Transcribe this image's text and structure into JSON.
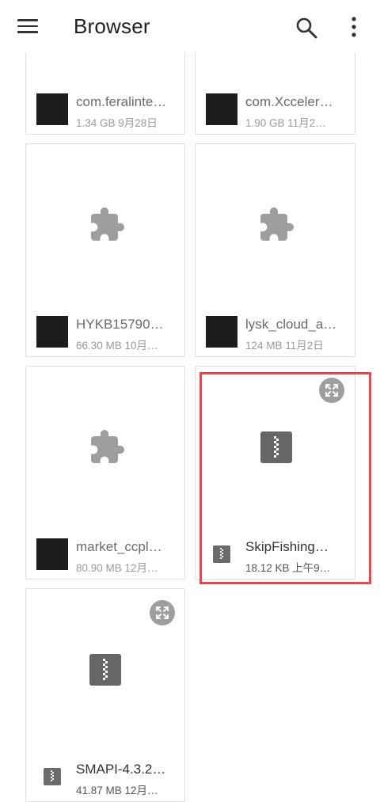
{
  "appbar": {
    "title": "Browser",
    "menu_icon": "hamburger-menu-icon",
    "search_icon": "search-icon",
    "more_icon": "more-vert-icon"
  },
  "files": [
    {
      "name": "com.feralinte…",
      "meta": "1.34 GB 9月28日",
      "type": "folder"
    },
    {
      "name": "com.Xcceler…",
      "meta": "1.90 GB 11月2…",
      "type": "folder"
    },
    {
      "name": "HYKB15790…",
      "meta": "66.30 MB 10月…",
      "type": "apk"
    },
    {
      "name": "lysk_cloud_a…",
      "meta": "124 MB 11月2日",
      "type": "apk"
    },
    {
      "name": "market_ccpl…",
      "meta": "80.90 MB 12月…",
      "type": "apk"
    },
    {
      "name": "SkipFishing…",
      "meta": "18.12 KB 上午9…",
      "type": "zip"
    },
    {
      "name": "SMAPI-4.3.2…",
      "meta": "41.87 MB 12月…",
      "type": "zip"
    }
  ],
  "colors": {
    "highlight": "#e5484d",
    "icon_gray": "#9e9e9e",
    "thumb": "#1c1c1c"
  }
}
